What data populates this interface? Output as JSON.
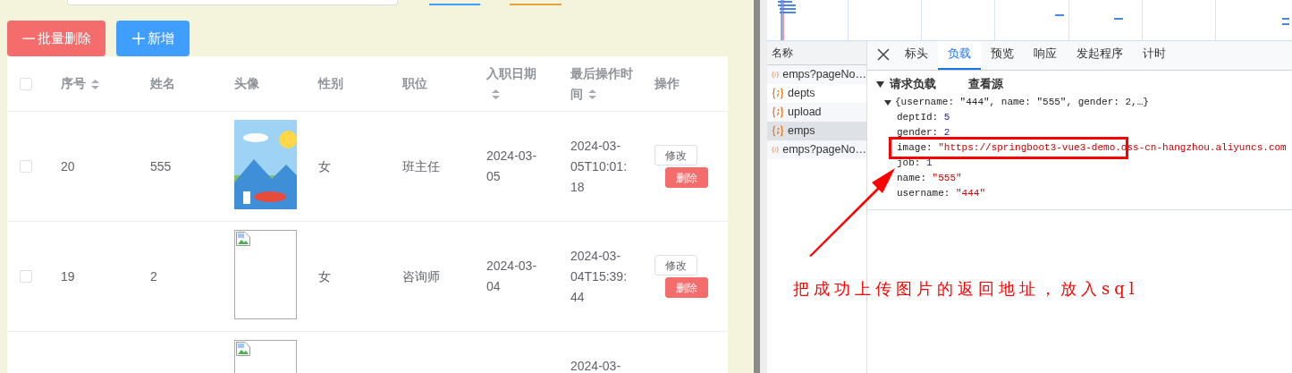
{
  "toolbar": {
    "buttons": [
      {
        "kind": "danger",
        "label": "批量删除"
      },
      {
        "kind": "primary",
        "label": "新增"
      }
    ]
  },
  "table": {
    "select_all": {
      "checked": false
    },
    "columns": [
      {
        "label": "序号",
        "sortable": true
      },
      {
        "label": "姓名",
        "sortable": false
      },
      {
        "label": "头像",
        "sortable": false
      },
      {
        "label": "性别",
        "sortable": false
      },
      {
        "label": "职位",
        "sortable": false
      },
      {
        "label": "入职日期",
        "sortable": true
      },
      {
        "label": "最后操作时间",
        "sortable": true
      },
      {
        "label": "操作",
        "sortable": false
      }
    ],
    "rows": [
      {
        "checked": false,
        "id": "20",
        "name": "555",
        "avatar": {
          "kind": "picture"
        },
        "gender": "女",
        "job": "班主任",
        "entry_date": "2024-03-05",
        "updated": "2024-03-05T10:01:18",
        "actions": [
          {
            "kind": "edit",
            "label": "修改"
          },
          {
            "kind": "delete",
            "label": "删除"
          }
        ]
      },
      {
        "checked": false,
        "id": "19",
        "name": "2",
        "avatar": {
          "kind": "broken"
        },
        "gender": "女",
        "job": "咨询师",
        "entry_date": "2024-03-04",
        "updated": "2024-03-04T15:39:44",
        "actions": [
          {
            "kind": "edit",
            "label": "修改"
          },
          {
            "kind": "delete",
            "label": "删除"
          }
        ]
      },
      {
        "avatar": {
          "kind": "broken"
        },
        "updated": "2024-03-"
      }
    ]
  },
  "devtools": {
    "requests": {
      "header": "名称",
      "items": [
        {
          "name": "emps?pageNo…",
          "selected": false
        },
        {
          "name": "depts",
          "selected": false
        },
        {
          "name": "upload",
          "selected": false
        },
        {
          "name": "emps",
          "selected": true
        },
        {
          "name": "emps?pageNo…",
          "selected": false
        }
      ]
    },
    "tabs": [
      {
        "label": "标头",
        "selected": false
      },
      {
        "label": "负载",
        "selected": true
      },
      {
        "label": "预览",
        "selected": false
      },
      {
        "label": "响应",
        "selected": false
      },
      {
        "label": "发起程序",
        "selected": false
      },
      {
        "label": "计时",
        "selected": false
      }
    ],
    "payload": {
      "section": "请求负载",
      "view_source": "查看源",
      "summary": "{username: \"444\", name: \"555\", gender: 2,…}",
      "fields": [
        {
          "key": "deptId:",
          "value": "5",
          "kind": "number",
          "highlighted": false
        },
        {
          "key": "gender:",
          "value": "2",
          "kind": "number",
          "highlighted": false
        },
        {
          "key": "image:",
          "value": "\"https://springboot3-vue3-demo.oss-cn-hangzhou.aliyuncs.com",
          "kind": "string",
          "highlighted": true
        },
        {
          "key": "job:",
          "value": "1",
          "kind": "number",
          "highlighted": false
        },
        {
          "key": "name:",
          "value": "\"555\"",
          "kind": "string",
          "highlighted": false
        },
        {
          "key": "username:",
          "value": "\"444\"",
          "kind": "string",
          "highlighted": false
        }
      ]
    }
  },
  "annotation": {
    "text": "把成功上传图片的返回地址，放入sql"
  }
}
